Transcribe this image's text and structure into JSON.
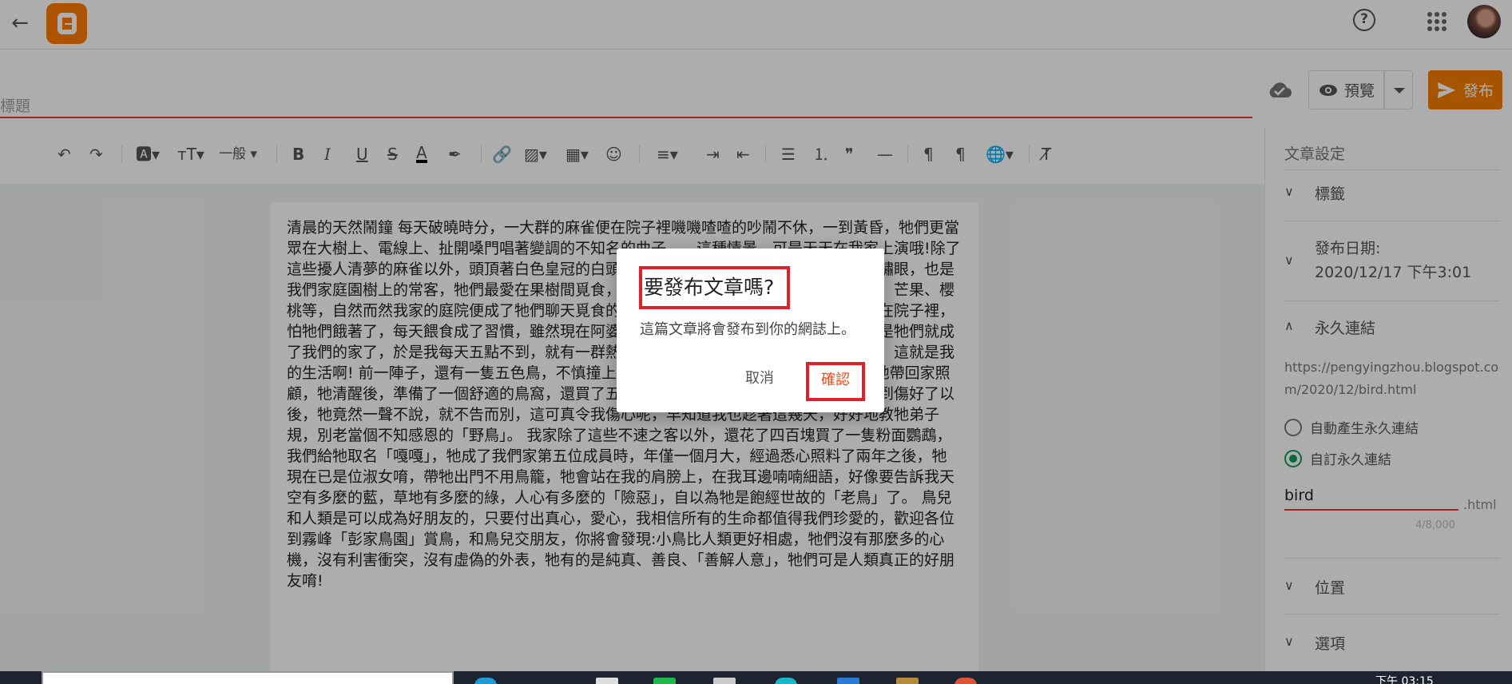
{
  "header": {
    "back": "←",
    "help": "?"
  },
  "title_placeholder": "標題",
  "actions": {
    "preview": "預覽",
    "publish": "發布"
  },
  "toolbar": {
    "font_size": "一般",
    "bold": "B",
    "italic": "I",
    "underline": "U",
    "strike": "S",
    "text_color": "A",
    "quote": "❞",
    "hr": "—"
  },
  "post_body": "清晨的天然鬧鐘 每天破曉時分，一大群的麻雀便在院子裡嘰嘰喳喳的吵鬧不休，一到黃昏，牠們更當眾在大樹上、電線上、扯開嗓門唱著變調的不知名的曲子……這種情景，可是天天在我家上演哦!除了這些擾人清夢的麻雀以外，頭頂著白色皇冠的白頭翁、身著綠色外衣，戴著白色眼圈的綠繡眼，也是我們家庭園樹上的常客，牠們最愛在果樹間覓食，院子裡種了許多果樹，像是芭樂、木瓜、芒果、櫻桃等，自然而然我家的庭院便成了牠們聊天覓食的天堂。阿婆看牠們可愛，總會放些飯粒在院子裡，怕牠們餓著了，每天餵食成了習慣，雖然現在阿婆不在了，但這份心意一直延續下去，於是牠們就成了我們的家了，於是我每天五點不到，就有一群熱心的「鳥」來叫我起床，真是吵死人了，這就是我的生活啊! 前一陣子，還有一隻五色鳥，不慎撞上了我們家的玻璃窗，暈了過去，我們把牠帶回家照顧，牠清醒後，準備了一個舒適的鳥窩，還買了五色鳥最愛吃的木瓜、香蕉等水果，沒想到傷好了以後，牠竟然一聲不說，就不告而別，這可真令我傷心呢，早知道我也趁著這幾天，好好地教牠弟子規，別老當個不知感恩的「野鳥」。 我家除了這些不速之客以外，還花了四百塊買了一隻粉面鸚鵡，我們給牠取名「嘎嘎」，牠成了我們家第五位成員時，年僅一個月大，經過悉心照料了兩年之後，牠現在已是位淑女唷，帶牠出門不用鳥籠，牠會站在我的肩膀上，在我耳邊喃喃細語，好像要告訴我天空有多麼的藍，草地有多麼的綠，人心有多麼的「險惡」，自以為牠是飽經世故的「老鳥」了。 鳥兒和人類是可以成為好朋友的，只要付出真心，愛心，我相信所有的生命都值得我們珍愛的，歡迎各位到霧峰「彭家鳥園」賞鳥，和鳥兒交朋友，你將會發現:小鳥比人類更好相處，牠們沒有那麼多的心機，沒有利害衝突，沒有虛偽的外表，牠有的是純真、善良、「善解人意」，牠們可是人類真正的好朋友唷!",
  "side": {
    "title": "文章設定",
    "labels": "標籤",
    "publish_date_label": "發布日期:",
    "publish_date_value": "2020/12/17 下午3:01",
    "permalink": "永久連結",
    "url": "https://pengyingzhou.blogspot.com/2020/12/bird.html",
    "auto": "自動產生永久連結",
    "custom": "自訂永久連結",
    "slug": "bird",
    "suffix": ".html",
    "counter": "4/8,000",
    "location": "位置",
    "options": "選項"
  },
  "dialog": {
    "title": "要發布文章嗎?",
    "message": "這篇文章將會發布到你的網誌上。",
    "cancel": "取消",
    "confirm": "確認"
  },
  "taskbar": {
    "clock": "下午 03:15"
  },
  "colors": {
    "accent": "#f57c00",
    "highlight_box": "#e0202b",
    "radio_on": "#0f9d58"
  }
}
